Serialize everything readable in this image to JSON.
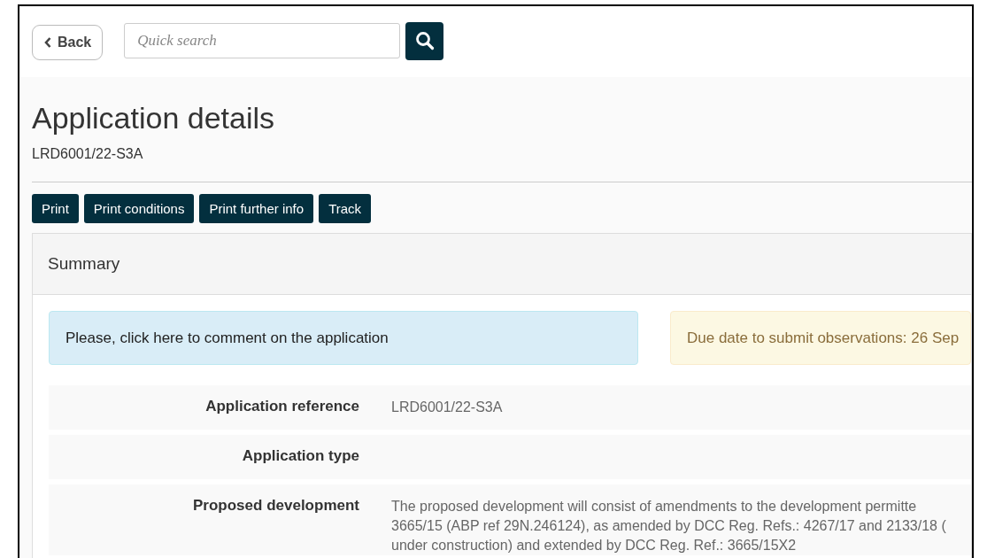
{
  "header": {
    "back_button": "Back",
    "search": {
      "placeholder": "Quick search"
    }
  },
  "page": {
    "title": "Application details",
    "reference": "LRD6001/22-S3A"
  },
  "actions": [
    "Print",
    "Print conditions",
    "Print further info",
    "Track"
  ],
  "summary": {
    "title": "Summary",
    "alerts": [
      {
        "kind": "info",
        "text": "Please, click here to comment on the application"
      },
      {
        "kind": "warning",
        "text": "Due date to submit observations: 26 Sep"
      }
    ],
    "rows": [
      {
        "label": "Application reference",
        "value_lines": [
          "LRD6001/22-S3A"
        ]
      },
      {
        "label": "Application type",
        "value_lines": []
      },
      {
        "label": "Proposed development",
        "value_lines": [
          "The proposed development will consist of amendments to the development permitte",
          "3665/15 (ABP ref 29N.246124), as amended by DCC Reg. Refs.: 4267/17 and 2133/18 (",
          "under construction) and extended by DCC Reg. Ref.: 3665/15X2"
        ]
      }
    ]
  }
}
